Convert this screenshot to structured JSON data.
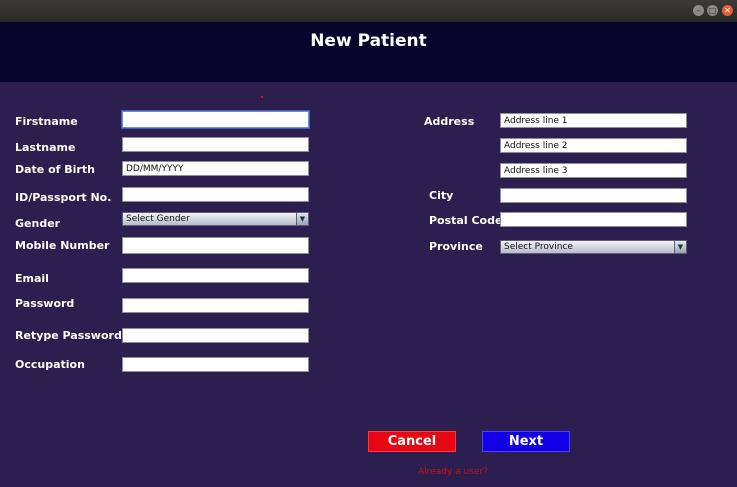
{
  "window": {
    "minimize": "–",
    "maximize": "□",
    "close": "✕"
  },
  "header": {
    "title": "New Patient"
  },
  "form": {
    "firstname": {
      "label": "Firstname",
      "value": ""
    },
    "lastname": {
      "label": "Lastname",
      "value": ""
    },
    "dob": {
      "label": "Date of Birth",
      "value": "DD/MM/YYYY"
    },
    "id_passport": {
      "label": "ID/Passport No.",
      "value": ""
    },
    "gender": {
      "label": "Gender",
      "selected": "Select Gender"
    },
    "mobile": {
      "label": "Mobile Number",
      "value": ""
    },
    "email": {
      "label": "Email",
      "value": ""
    },
    "password": {
      "label": "Password",
      "value": ""
    },
    "retype_password": {
      "label": "Retype Password",
      "value": ""
    },
    "occupation": {
      "label": "Occupation",
      "value": ""
    },
    "address": {
      "label": "Address",
      "line1": "Address line 1",
      "line2": "Address line 2",
      "line3": "Address line 3"
    },
    "city": {
      "label": "City",
      "value": ""
    },
    "postal_code": {
      "label": "Postal Code",
      "value": ""
    },
    "province": {
      "label": "Province",
      "selected": "Select Province"
    }
  },
  "actions": {
    "cancel": "Cancel",
    "next": "Next",
    "login_link": "Already a user?"
  },
  "colors": {
    "background": "#2c1f4f",
    "header": "#06052e",
    "cancel": "#e80613",
    "next": "#1400e6",
    "link": "#c2131e"
  }
}
